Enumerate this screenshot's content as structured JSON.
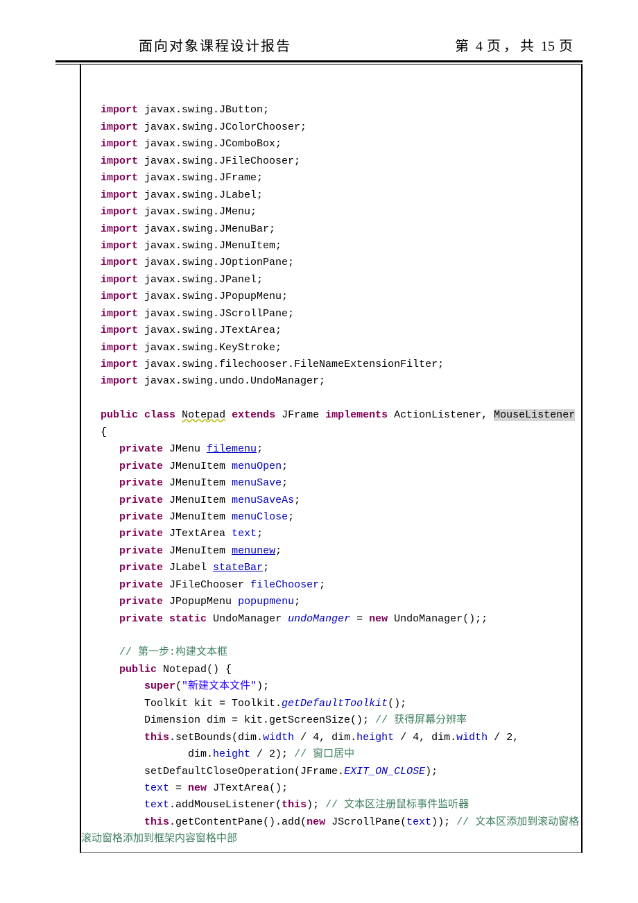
{
  "header": {
    "title": "面向对象课程设计报告",
    "page_label_1": "第",
    "page_current": "4",
    "page_label_2": "页，共",
    "page_total": "15",
    "page_label_3": "页"
  },
  "code": {
    "imports": [
      "javax.swing.JButton;",
      "javax.swing.JColorChooser;",
      "javax.swing.JComboBox;",
      "javax.swing.JFileChooser;",
      "javax.swing.JFrame;",
      "javax.swing.JLabel;",
      "javax.swing.JMenu;",
      "javax.swing.JMenuBar;",
      "javax.swing.JMenuItem;",
      "javax.swing.JOptionPane;",
      "javax.swing.JPanel;",
      "javax.swing.JPopupMenu;",
      "javax.swing.JScrollPane;",
      "javax.swing.JTextArea;",
      "javax.swing.KeyStroke;",
      "javax.swing.filechooser.FileNameExtensionFilter;",
      "javax.swing.undo.UndoManager;"
    ],
    "kw_import": "import",
    "kw_public": "public",
    "kw_class": "class",
    "kw_extends": "extends",
    "kw_implements": "implements",
    "kw_private": "private",
    "kw_static": "static",
    "kw_new": "new",
    "kw_super": "super",
    "kw_this": "this",
    "class_name": "Notepad",
    "super_class": " JFrame ",
    "iface1": " ActionListener, ",
    "iface2": "MouseListener",
    "fields": {
      "f1_type": " JMenu ",
      "f1_name": "filemenu",
      "f2_type": " JMenuItem ",
      "f2_name": "menuOpen",
      "f3_type": " JMenuItem ",
      "f3_name": "menuSave",
      "f4_type": " JMenuItem ",
      "f4_name": "menuSaveAs",
      "f5_type": " JMenuItem ",
      "f5_name": "menuClose",
      "f6_type": " JTextArea ",
      "f6_name": "text",
      "f7_type": " JMenuItem ",
      "f7_name": "menunew",
      "f8_type": " JLabel ",
      "f8_name": "stateBar",
      "f9_type": " JFileChooser ",
      "f9_name": "fileChooser",
      "f10_type": " JPopupMenu ",
      "f10_name": "popupmenu",
      "f11_type": " UndoManager ",
      "f11_name": "undoManger",
      "f11_init": " UndoManager();;"
    },
    "comment1": "// 第一步:构建文本框",
    "ctor_sig": " Notepad() {",
    "super_arg": "\"新建文本文件\"",
    "line_toolkit_a": "       Toolkit kit = Toolkit.",
    "line_toolkit_b": "getDefaultToolkit",
    "line_toolkit_c": "();",
    "line_dim_a": "       Dimension dim = kit.getScreenSize(); ",
    "line_dim_b": "// 获得屏幕分辨率",
    "line_bounds_a": ".setBounds(dim.",
    "line_bounds_b": " / 4, dim.",
    "line_bounds_c": " / 4, dim.",
    "line_bounds_d": " / 2,",
    "line_bounds2_a": "              dim.",
    "line_bounds2_b": " / 2); ",
    "line_bounds2_c": "// 窗口居中",
    "width": "width",
    "height": "height",
    "line_close_a": "       setDefaultCloseOperation(JFrame.",
    "line_close_b": "EXIT_ON_CLOSE",
    "line_close_c": ");",
    "line_text_a": " = ",
    "line_text_b": " JTextArea();",
    "line_mouse_a": ".addMouseListener(",
    "line_mouse_b": "); ",
    "line_mouse_c": "// 文本区注册鼠标事件监听器",
    "line_content_a": ".getContentPane().add(",
    "line_content_b": " JScrollPane(",
    "line_content_c": ")); ",
    "line_content_d": "// 文本区添加到滚动窗格",
    "overflow": "滚动窗格添加到框架内容窗格中部"
  }
}
